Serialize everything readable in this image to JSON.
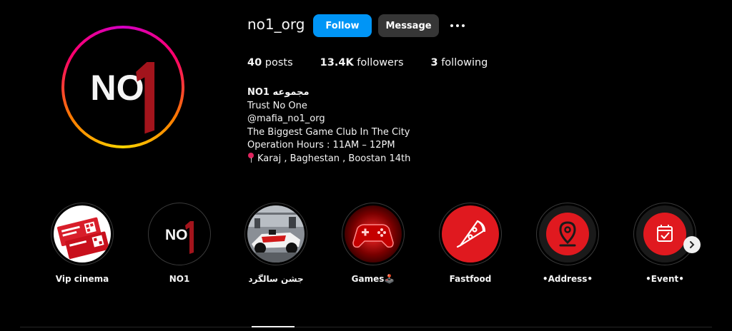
{
  "profile": {
    "username": "no1_org",
    "follow_label": "Follow",
    "message_label": "Message",
    "more_icon": "more-options-icon",
    "avatar_text": "NO1"
  },
  "stats": {
    "posts_count": "40",
    "posts_label": "posts",
    "followers_count": "13.4K",
    "followers_label": "followers",
    "following_count": "3",
    "following_label": "following"
  },
  "bio": {
    "name": "NO1 مجموعه",
    "line1": "Trust No One",
    "line2": "@mafia_no1_org",
    "line3": "The Biggest Game Club In The City",
    "line4": "Operation Hours : 11AM – 12PM",
    "line5": "Karaj , Baghestan , Boostan 14th"
  },
  "highlights": [
    {
      "label": "Vip cinema",
      "cover": "cinema-ticket"
    },
    {
      "label": "NO1",
      "cover": "no1-logo"
    },
    {
      "label": "جشن سالگرد",
      "cover": "race-car-photo"
    },
    {
      "label": "Games🕹️",
      "cover": "gamepad-icon"
    },
    {
      "label": "Fastfood",
      "cover": "pizza-icon"
    },
    {
      "label": "•Address•",
      "cover": "location-pin-icon"
    },
    {
      "label": "•Event•",
      "cover": "calendar-icon"
    }
  ],
  "colors": {
    "background": "#000000",
    "follow_button": "#0095f6",
    "message_button": "#363636",
    "highlight_red": "#e0191f"
  }
}
